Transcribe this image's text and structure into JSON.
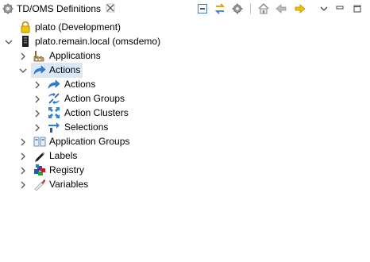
{
  "tab": {
    "title": "TD/OMS Definitions",
    "icon": "gear-icon",
    "close_icon": "close-icon"
  },
  "toolbar": [
    {
      "name": "collapse-all-icon"
    },
    {
      "name": "link-with-editor-icon"
    },
    {
      "name": "settings-gear-icon"
    },
    {
      "name": "home-icon"
    },
    {
      "name": "back-arrow-icon"
    },
    {
      "name": "forward-arrow-icon"
    },
    {
      "name": "view-menu-icon"
    },
    {
      "name": "minimize-icon"
    },
    {
      "name": "maximize-icon"
    }
  ],
  "tree": {
    "items": [
      {
        "label": "plato (Development)",
        "icon": "lock-icon",
        "expanded": null
      },
      {
        "label": "plato.remain.local (omsdemo)",
        "icon": "server-icon",
        "expanded": true
      },
      {
        "label": "Applications",
        "icon": "factory-icon",
        "expanded": false
      },
      {
        "label": "Actions",
        "icon": "action-arrow-icon",
        "expanded": true,
        "selected": true
      },
      {
        "label": "Actions",
        "icon": "action-arrow-icon",
        "expanded": false
      },
      {
        "label": "Action Groups",
        "icon": "action-groups-icon",
        "expanded": false
      },
      {
        "label": "Action Clusters",
        "icon": "action-clusters-icon",
        "expanded": false
      },
      {
        "label": "Selections",
        "icon": "selections-icon",
        "expanded": false
      },
      {
        "label": "Application Groups",
        "icon": "application-groups-icon",
        "expanded": false
      },
      {
        "label": "Labels",
        "icon": "label-pen-icon",
        "expanded": false
      },
      {
        "label": "Registry",
        "icon": "registry-icon",
        "expanded": false
      },
      {
        "label": "Variables",
        "icon": "variables-icon",
        "expanded": false
      }
    ]
  },
  "colors": {
    "selection": "#dae8f6",
    "accent_blue": "#2f7fd6",
    "twistie": "#555555"
  }
}
